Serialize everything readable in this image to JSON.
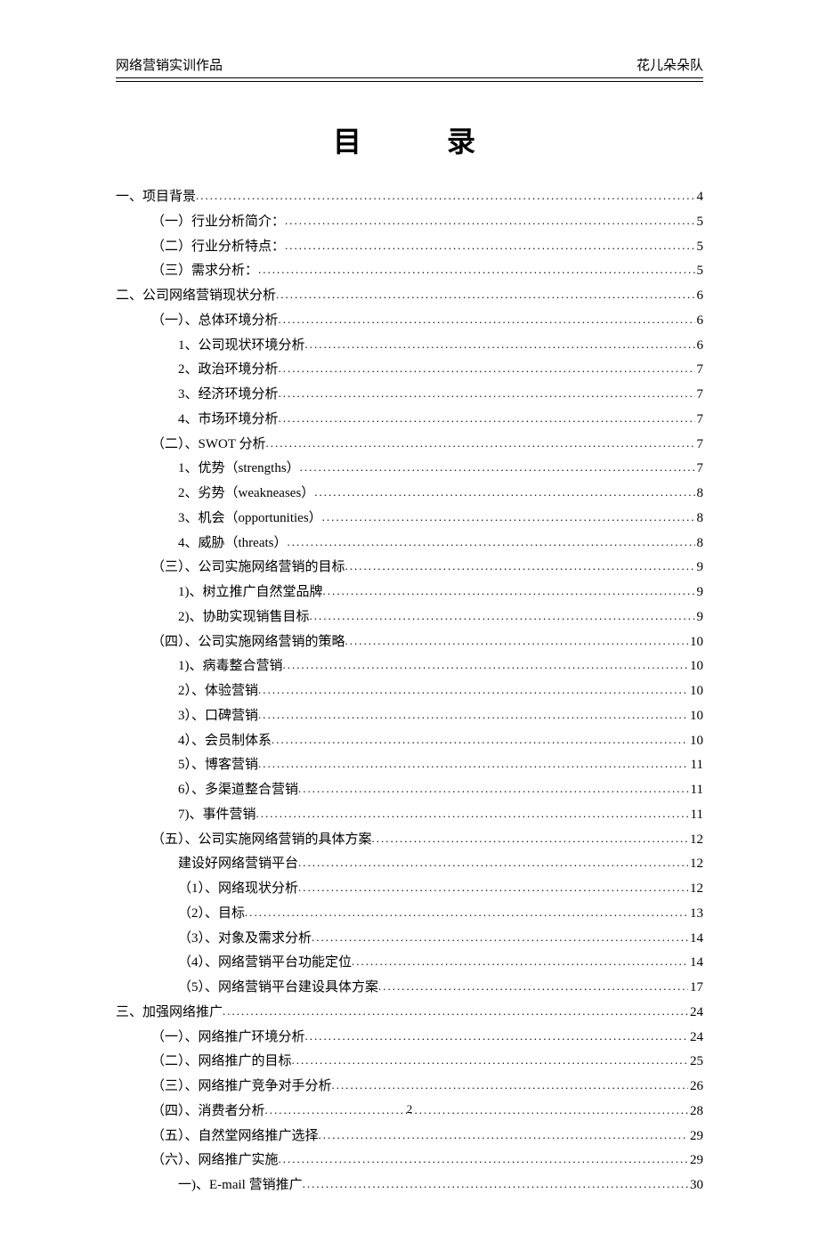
{
  "header_left": "网络营销实训作品",
  "header_right": "花儿朵朵队",
  "title": "目　录",
  "page_number": "2",
  "toc": [
    {
      "indent": 0,
      "label": "一、项目背景",
      "page": "4"
    },
    {
      "indent": 1,
      "label": "（一）行业分析简介：",
      "page": "5"
    },
    {
      "indent": 1,
      "label": "（二）行业分析特点：",
      "page": "5"
    },
    {
      "indent": 1,
      "label": "（三）需求分析：",
      "page": "5"
    },
    {
      "indent": 0,
      "label": "二、公司网络营销现状分析",
      "page": "6"
    },
    {
      "indent": 1,
      "label": "（一）、总体环境分析",
      "page": "6"
    },
    {
      "indent": 2,
      "label": "1、公司现状环境分析",
      "page": "6"
    },
    {
      "indent": 2,
      "label": "2、政治环境分析",
      "page": "7"
    },
    {
      "indent": 2,
      "label": "3、经济环境分析",
      "page": "7"
    },
    {
      "indent": 2,
      "label": "4、市场环境分析",
      "page": "7"
    },
    {
      "indent": 1,
      "label": "（二）、SWOT 分析",
      "page": "7"
    },
    {
      "indent": 2,
      "label": "1、优势（strengths）",
      "page": "7"
    },
    {
      "indent": 2,
      "label": "2、劣势（weakneases）",
      "page": "8"
    },
    {
      "indent": 2,
      "label": "3、机会（opportunities）",
      "page": "8"
    },
    {
      "indent": 2,
      "label": "4、威胁（threats）",
      "page": "8"
    },
    {
      "indent": 1,
      "label": "（三）、公司实施网络营销的目标",
      "page": "9"
    },
    {
      "indent": 2,
      "label": "1)、树立推广自然堂品牌",
      "page": "9"
    },
    {
      "indent": 2,
      "label": "2)、协助实现销售目标",
      "page": "9"
    },
    {
      "indent": 1,
      "label": "（四）、公司实施网络营销的策略",
      "page": "10"
    },
    {
      "indent": 2,
      "label": "1)、病毒整合营销",
      "page": "10"
    },
    {
      "indent": 2,
      "label": "2）、体验营销",
      "page": "10"
    },
    {
      "indent": 2,
      "label": "3）、口碑营销",
      "page": "10"
    },
    {
      "indent": 2,
      "label": "4）、会员制体系",
      "page": "10"
    },
    {
      "indent": 2,
      "label": "5）、博客营销",
      "page": "11"
    },
    {
      "indent": 2,
      "label": "6）、多渠道整合营销",
      "page": "11"
    },
    {
      "indent": 2,
      "label": "7)、事件营销",
      "page": "11"
    },
    {
      "indent": 1,
      "label": "（五）、公司实施网络营销的具体方案",
      "page": "12"
    },
    {
      "indent": 2,
      "label": "建设好网络营销平台",
      "page": "12"
    },
    {
      "indent": 2,
      "label": "（1）、网络现状分析",
      "page": "12"
    },
    {
      "indent": 2,
      "label": "（2）、目标",
      "page": "13"
    },
    {
      "indent": 2,
      "label": "（3）、对象及需求分析",
      "page": "14"
    },
    {
      "indent": 2,
      "label": "（4）、网络营销平台功能定位",
      "page": "14"
    },
    {
      "indent": 2,
      "label": "（5）、网络营销平台建设具体方案",
      "page": "17"
    },
    {
      "indent": 0,
      "label": "三、加强网络推广",
      "page": "24"
    },
    {
      "indent": 1,
      "label": "（一）、网络推广环境分析",
      "page": "24"
    },
    {
      "indent": 1,
      "label": "（二）、网络推广的目标",
      "page": "25"
    },
    {
      "indent": 1,
      "label": "（三）、网络推广竞争对手分析",
      "page": "26"
    },
    {
      "indent": 1,
      "label": "（四）、消费者分析",
      "page": "28"
    },
    {
      "indent": 1,
      "label": "（五）、自然堂网络推广选择",
      "page": "29"
    },
    {
      "indent": 1,
      "label": "（六）、网络推广实施",
      "page": "29"
    },
    {
      "indent": 2,
      "label": "一)、E-mail 营销推广",
      "page": "30"
    }
  ]
}
